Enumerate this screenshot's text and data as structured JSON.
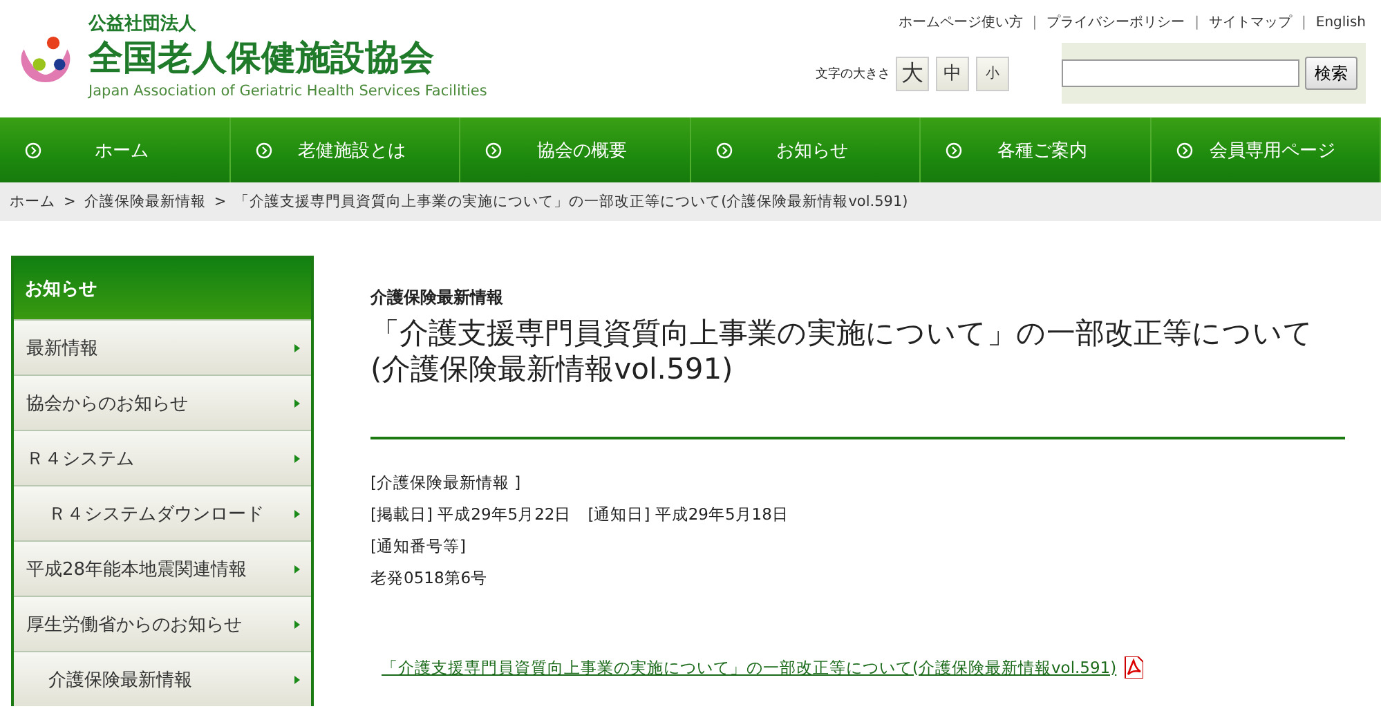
{
  "header": {
    "org_type": "公益社団法人",
    "org_name": "全国老人保健施設協会",
    "org_name_en": "Japan Association of Geriatric Health Services Facilities",
    "utility_links": [
      "ホームページ使い方",
      "プライバシーポリシー",
      "サイトマップ",
      "English"
    ],
    "utility_separator": "|",
    "font_size": {
      "label": "文字の大きさ",
      "options": [
        "大",
        "中",
        "小"
      ]
    },
    "search": {
      "button": "検索"
    }
  },
  "nav": [
    "ホーム",
    "老健施設とは",
    "協会の概要",
    "お知らせ",
    "各種ご案内",
    "会員専用ページ"
  ],
  "breadcrumb_separator": ">",
  "breadcrumb": [
    "ホーム",
    "介護保険最新情報",
    "「介護支援専門員資質向上事業の実施について」の一部改正等について(介護保険最新情報vol.591)"
  ],
  "sidebar": {
    "title": "お知らせ",
    "items": [
      {
        "label": "最新情報"
      },
      {
        "label": "協会からのお知らせ"
      },
      {
        "label": "Ｒ４システム",
        "children": [
          {
            "label": "Ｒ４システムダウンロード"
          }
        ]
      },
      {
        "label": "平成28年能本地震関連情報"
      },
      {
        "label": "厚生労働省からのお知らせ",
        "children": [
          {
            "label": "介護保険最新情報"
          }
        ]
      }
    ]
  },
  "article": {
    "category": "介護保険最新情報",
    "title": "「介護支援専門員資質向上事業の実施について」の一部改正等について(介護保険最新情報vol.591)",
    "meta": [
      "[介護保険最新情報 ]",
      "[掲載日] 平成29年5月22日　[通知日] 平成29年5月18日",
      "[通知番号等]",
      "老発0518第6号"
    ],
    "attachment": "「介護支援専門員資質向上事業の実施について」の一部改正等について(介護保険最新情報vol.591)"
  }
}
